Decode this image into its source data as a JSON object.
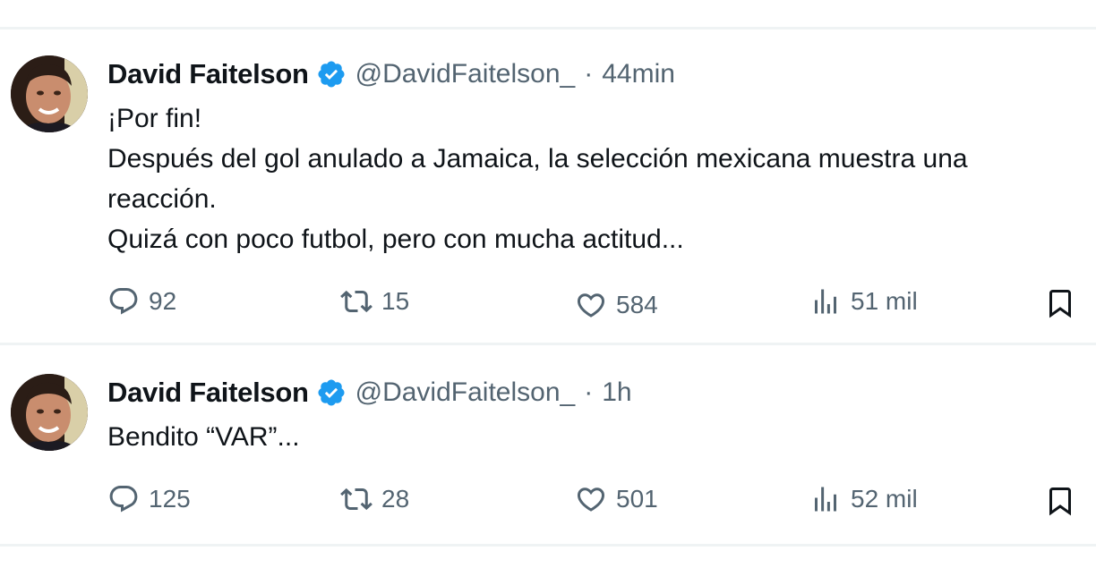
{
  "tweets": [
    {
      "author_name": "David Faitelson",
      "handle": "@DavidFaitelson_",
      "separator": "·",
      "time": "44min",
      "body_lines": [
        "¡Por fin!",
        "Después del gol anulado a Jamaica, la selección mexicana muestra una reacción.",
        "Quizá con poco futbol, pero con mucha actitud..."
      ],
      "replies": "92",
      "retweets": "15",
      "likes": "584",
      "views": "51 mil"
    },
    {
      "author_name": "David Faitelson",
      "handle": "@DavidFaitelson_",
      "separator": "·",
      "time": "1h",
      "body_lines": [
        "Bendito “VAR”..."
      ],
      "replies": "125",
      "retweets": "28",
      "likes": "501",
      "views": "52 mil"
    }
  ],
  "colors": {
    "text": "#0f1419",
    "muted": "#536471",
    "verified": "#1d9bf0",
    "divider": "#eff3f4"
  },
  "icons": [
    "reply-icon",
    "retweet-icon",
    "like-icon",
    "views-icon",
    "bookmark-icon",
    "verified-badge-icon"
  ]
}
